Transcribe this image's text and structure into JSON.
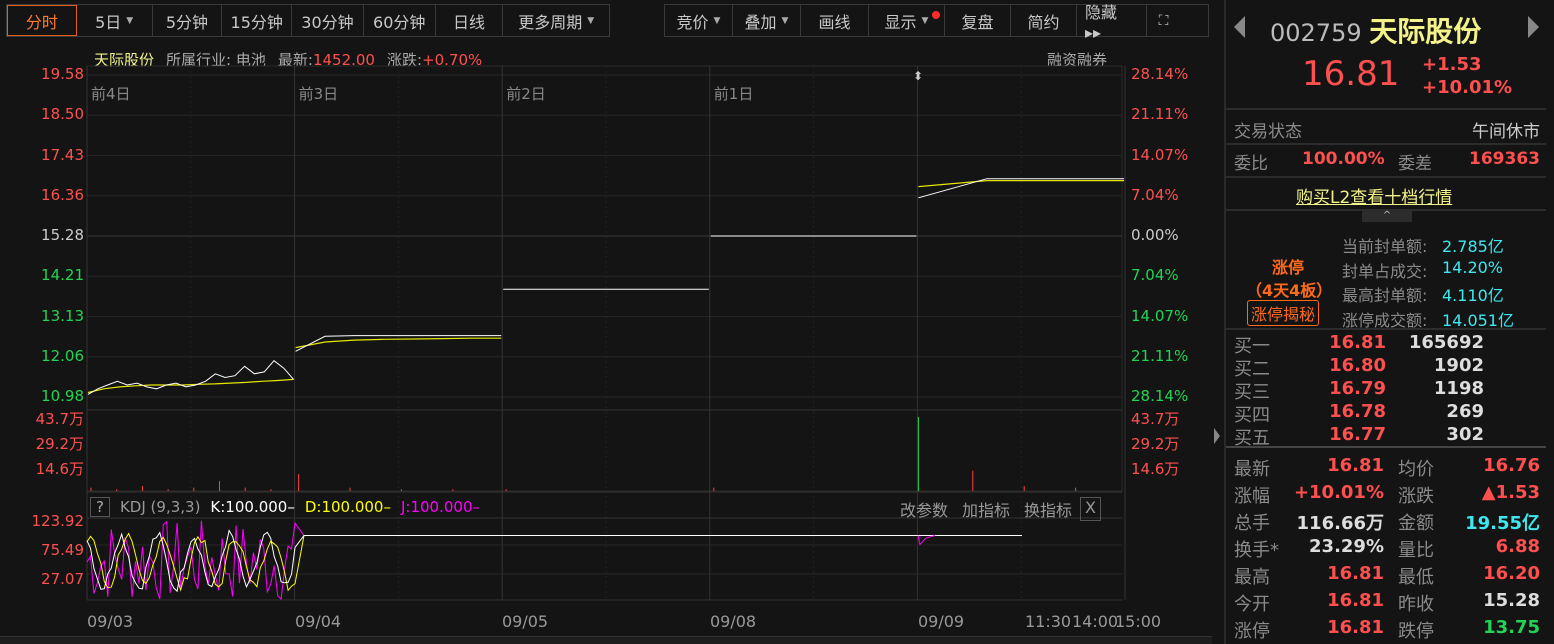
{
  "toolbar_left": [
    {
      "label": "分时",
      "active": true
    },
    {
      "label": "5日",
      "caret": true
    },
    {
      "label": "5分钟"
    },
    {
      "label": "15分钟"
    },
    {
      "label": "30分钟"
    },
    {
      "label": "60分钟"
    },
    {
      "label": "日线"
    },
    {
      "label": "更多周期",
      "caret": true
    }
  ],
  "toolbar_right": [
    {
      "label": "竞价",
      "caret": true
    },
    {
      "label": "叠加",
      "caret": true
    },
    {
      "label": "画线"
    },
    {
      "label": "显示",
      "caret": true,
      "dot": true
    },
    {
      "label": "复盘"
    },
    {
      "label": "简约"
    },
    {
      "label": "隐藏 ▸▸"
    }
  ],
  "info": {
    "name": "天际股份",
    "industry_label": "所属行业:",
    "industry": "电池",
    "latest_label": "最新:",
    "latest": "1452.00",
    "change_label": "涨跌:",
    "change": "+0.70%",
    "margin": "融资融券"
  },
  "price_axis_left": [
    "19.58",
    "18.50",
    "17.43",
    "16.36",
    "15.28",
    "14.21",
    "13.13",
    "12.06",
    "10.98"
  ],
  "price_axis_right": [
    "28.14%",
    "21.11%",
    "14.07%",
    "7.04%",
    "0.00%",
    "7.04%",
    "14.07%",
    "21.11%",
    "28.14%"
  ],
  "day_labels": [
    "前4日",
    "前3日",
    "前2日",
    "前1日"
  ],
  "volume_axis": [
    "43.7万",
    "29.2万",
    "14.6万"
  ],
  "kdj": {
    "help": "?",
    "name": "KDJ (9,3,3)",
    "k": "K:100.000–",
    "d": "D:100.000–",
    "j": "J:100.000–",
    "btn_params": "改参数",
    "btn_add": "加指标",
    "btn_switch": "换指标",
    "close": "X",
    "axis": [
      "123.92",
      "75.49",
      "27.07"
    ]
  },
  "x_labels": [
    "09/03",
    "09/04",
    "09/05",
    "09/08",
    "09/09",
    "11:30",
    "14:00",
    "15:00"
  ],
  "chart_data": {
    "type": "line",
    "prev_close": 15.28,
    "ylim": [
      10.98,
      19.58
    ],
    "days": [
      {
        "price": [
          11.05,
          11.2,
          11.3,
          11.4,
          11.3,
          11.35,
          11.25,
          11.2,
          11.3,
          11.35,
          11.25,
          11.3,
          11.4,
          11.6,
          11.5,
          11.55,
          11.8,
          11.6,
          11.65,
          11.95,
          11.75,
          11.45
        ],
        "avg": [
          11.1,
          11.2,
          11.25,
          11.28,
          11.3,
          11.3,
          11.3,
          11.32,
          11.33,
          11.35,
          11.37,
          11.4,
          11.42,
          11.45
        ]
      },
      {
        "price": [
          12.2,
          12.6,
          12.62,
          12.62,
          12.62,
          12.62,
          12.62,
          12.62
        ],
        "avg": [
          12.3,
          12.45,
          12.5,
          12.52,
          12.53,
          12.54,
          12.55,
          12.55
        ]
      },
      {
        "price": [
          13.86,
          13.86
        ]
      },
      {
        "price": [
          15.28,
          15.28
        ]
      },
      {
        "price": [
          16.3,
          16.81,
          16.81,
          16.81
        ],
        "avg": [
          16.6,
          16.76,
          16.76,
          16.76
        ]
      }
    ],
    "volume": [
      [
        2,
        1,
        3,
        1,
        2,
        6,
        2,
        1
      ],
      [
        10,
        2,
        1,
        1
      ],
      [
        1
      ],
      [
        2
      ],
      [
        43.7,
        12,
        3,
        2
      ]
    ]
  },
  "quote": {
    "code": "002759",
    "name": "天际股份",
    "price": "16.81",
    "change": "+1.53",
    "pct": "+10.01%"
  },
  "status": {
    "label": "交易状态",
    "value": "午间休市"
  },
  "wei": {
    "ratio_label": "委比",
    "ratio": "100.00%",
    "diff_label": "委差",
    "diff": "169363"
  },
  "l2_link": "购买L2查看十档行情",
  "limit": {
    "title": "涨停",
    "boards": "（4天4板）",
    "btn": "涨停揭秘",
    "rows": [
      {
        "k": "当前封单额:",
        "v": "2.785亿"
      },
      {
        "k": "封单占成交:",
        "v": "14.20%"
      },
      {
        "k": "最高封单额:",
        "v": "4.110亿"
      },
      {
        "k": "涨停成交额:",
        "v": "14.051亿"
      }
    ]
  },
  "bids": [
    {
      "k": "买一",
      "p": "16.81",
      "v": "165692"
    },
    {
      "k": "买二",
      "p": "16.80",
      "v": "1902"
    },
    {
      "k": "买三",
      "p": "16.79",
      "v": "1198"
    },
    {
      "k": "买四",
      "p": "16.78",
      "v": "269"
    },
    {
      "k": "买五",
      "p": "16.77",
      "v": "302"
    }
  ],
  "stats": [
    {
      "k1": "最新",
      "v1": "16.81",
      "c1": "red",
      "k2": "均价",
      "v2": "16.76",
      "c2": "red"
    },
    {
      "k1": "涨幅",
      "v1": "+10.01%",
      "c1": "red",
      "k2": "涨跌",
      "v2": "▲1.53",
      "c2": "red"
    },
    {
      "k1": "总手",
      "v1": "116.66万",
      "c1": "white",
      "k2": "金额",
      "v2": "19.55亿",
      "c2": "cyan"
    },
    {
      "k1": "换手*",
      "v1": "23.29%",
      "c1": "white",
      "k2": "量比",
      "v2": "6.88",
      "c2": "red"
    },
    {
      "k1": "最高",
      "v1": "16.81",
      "c1": "red",
      "k2": "最低",
      "v2": "16.20",
      "c2": "red"
    },
    {
      "k1": "今开",
      "v1": "16.81",
      "c1": "red",
      "k2": "昨收",
      "v2": "15.28",
      "c2": "white"
    },
    {
      "k1": "涨停",
      "v1": "16.81",
      "c1": "red",
      "k2": "跌停",
      "v2": "13.75",
      "c2": "green"
    }
  ]
}
